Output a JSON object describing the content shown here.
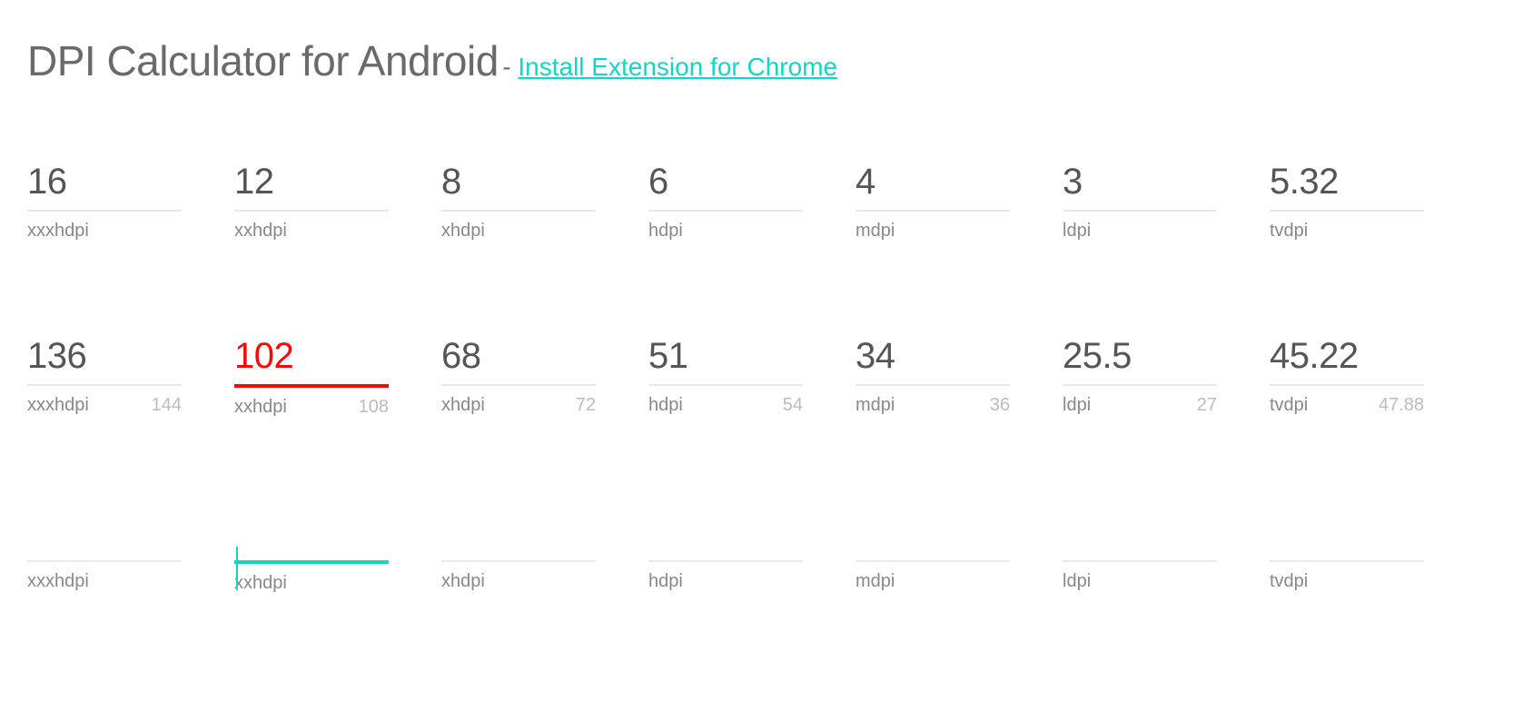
{
  "header": {
    "title": "DPI Calculator for Android",
    "separator": " - ",
    "link_text": "Install Extension for Chrome"
  },
  "densities": [
    "xxxhdpi",
    "xxhdpi",
    "xhdpi",
    "hdpi",
    "mdpi",
    "ldpi",
    "tvdpi"
  ],
  "rows": [
    {
      "values": [
        "16",
        "12",
        "8",
        "6",
        "4",
        "3",
        "5.32"
      ],
      "aux": [
        "",
        "",
        "",
        "",
        "",
        "",
        ""
      ],
      "active_index": null,
      "active_style": null
    },
    {
      "values": [
        "136",
        "102",
        "68",
        "51",
        "34",
        "25.5",
        "45.22"
      ],
      "aux": [
        "144",
        "108",
        "72",
        "54",
        "36",
        "27",
        "47.88"
      ],
      "active_index": 1,
      "active_style": "red"
    },
    {
      "values": [
        "",
        "",
        "",
        "",
        "",
        "",
        ""
      ],
      "aux": [
        "",
        "",
        "",
        "",
        "",
        "",
        ""
      ],
      "active_index": 1,
      "active_style": "teal"
    }
  ]
}
